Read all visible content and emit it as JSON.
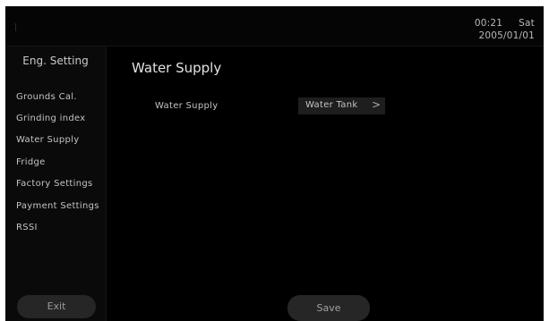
{
  "status": {
    "time": "00:21",
    "day": "Sat",
    "date": "2005/01/01"
  },
  "sidebar": {
    "title": "Eng. Setting",
    "items": [
      {
        "label": "Grounds Cal."
      },
      {
        "label": "Grinding index"
      },
      {
        "label": "Water Supply"
      },
      {
        "label": "Fridge"
      },
      {
        "label": "Factory Settings"
      },
      {
        "label": "Payment Settings"
      },
      {
        "label": "RSSI"
      }
    ],
    "exit_label": "Exit"
  },
  "main": {
    "title": "Water Supply",
    "field_label": "Water Supply",
    "field_value": "Water Tank",
    "chevron": ">",
    "save_label": "Save"
  }
}
